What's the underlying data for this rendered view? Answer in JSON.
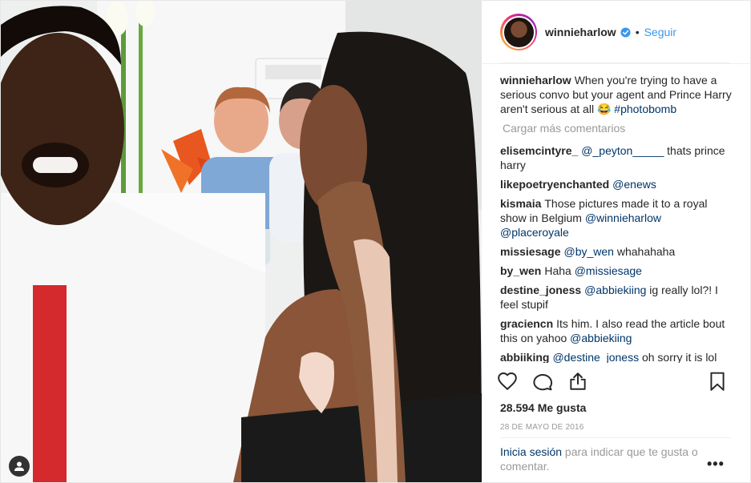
{
  "header": {
    "username": "winnieharlow",
    "separator": "•",
    "follow_label": "Seguir"
  },
  "caption": {
    "username": "winnieharlow",
    "text": "When you're trying to have a serious convo but your agent and Prince Harry aren't serious at all 😂",
    "hashtag": "#photobomb"
  },
  "load_more_label": "Cargar más comentarios",
  "comments": [
    {
      "user": "elisemcintyre_",
      "mention": "@_peyton_____",
      "text": " thats prince harry"
    },
    {
      "user": "likepoetryenchanted",
      "mention": "@enews",
      "text": ""
    },
    {
      "user": "kismaia",
      "pre": "Those pictures made it to a royal show in Belgium ",
      "mention": "@winnieharlow",
      "mention2": "@placeroyale",
      "text": ""
    },
    {
      "user": "missiesage",
      "mention": "@by_wen",
      "text": " whahahaha"
    },
    {
      "user": "by_wen",
      "pre": "Haha ",
      "mention": "@missiesage",
      "text": ""
    },
    {
      "user": "destine_joness",
      "mention": "@abbiekiing",
      "text": " ig really lol?! I feel stupif"
    },
    {
      "user": "graciencn",
      "pre": "Its him. I also read the article bout this on yahoo ",
      "mention": "@abbiekiing",
      "text": ""
    },
    {
      "user": "abbiiking",
      "mention": "@destine_joness",
      "text": " oh sorry it is lol"
    }
  ],
  "likes": "28.594 Me gusta",
  "date": "28 DE MAYO DE 2016",
  "login": {
    "link": "Inicia sesión",
    "text": " para indicar que te gusta o comentar."
  },
  "more_label": "•••",
  "icons": {
    "like": "heart-icon",
    "comment": "comment-icon",
    "share": "share-icon",
    "save": "bookmark-icon",
    "verified": "verified-badge-icon",
    "user_tag": "user-tag-icon"
  },
  "colors": {
    "link": "#3897f0",
    "mention": "#003569",
    "muted": "#999999"
  }
}
